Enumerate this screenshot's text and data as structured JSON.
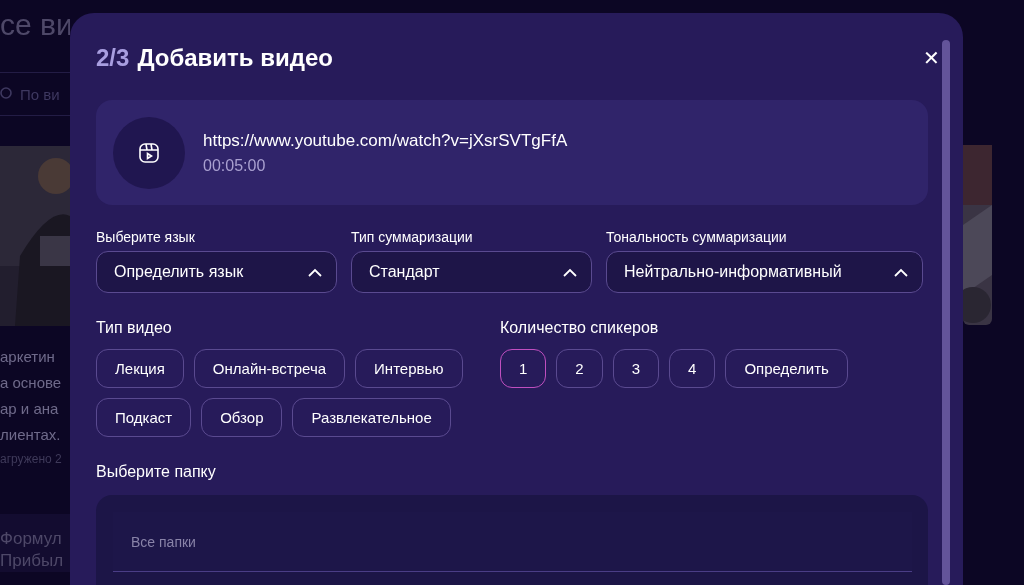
{
  "background": {
    "heading": "се ви",
    "search": {
      "placeholder": "По ви"
    },
    "card_lines": [
      "аркетин",
      "а основе",
      "ар и ана",
      "лиентах."
    ],
    "card_meta": "агружено 2",
    "card2_lines": [
      "Формул",
      "Прибыл"
    ]
  },
  "modal": {
    "step": "2/3",
    "title": "Добавить видео",
    "close": "✕",
    "video": {
      "url": "https://www.youtube.com/watch?v=jXsrSVTgFfA",
      "duration": "00:05:00"
    },
    "selects": [
      {
        "label": "Выберите язык",
        "value": "Определить язык"
      },
      {
        "label": "Тип суммаризации",
        "value": "Стандарт"
      },
      {
        "label": "Тональность суммаризации",
        "value": "Нейтрально-информативный"
      }
    ],
    "video_type": {
      "label": "Тип видео",
      "options": [
        {
          "label": "Лекция",
          "selected": false
        },
        {
          "label": "Онлайн-встреча",
          "selected": false
        },
        {
          "label": "Интервью",
          "selected": false
        },
        {
          "label": "Подкаст",
          "selected": false
        },
        {
          "label": "Обзор",
          "selected": false
        },
        {
          "label": "Развлекательное",
          "selected": false
        }
      ]
    },
    "speakers": {
      "label": "Количество спикеров",
      "options": [
        {
          "label": "1",
          "selected": true
        },
        {
          "label": "2",
          "selected": false
        },
        {
          "label": "3",
          "selected": false
        },
        {
          "label": "4",
          "selected": false
        },
        {
          "label": "Определить",
          "selected": false
        }
      ]
    },
    "folder": {
      "label": "Выберите папку",
      "placeholder": "Все папки"
    }
  }
}
